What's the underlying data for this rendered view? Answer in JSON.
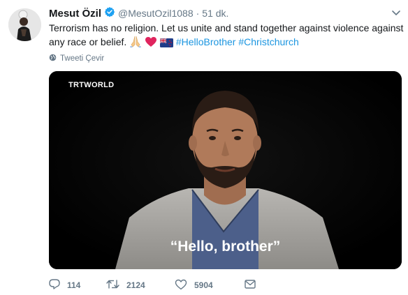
{
  "tweet": {
    "author": {
      "name": "Mesut Özil",
      "handle": "@MesutOzil1088",
      "separator": "·",
      "time": "51 dk."
    },
    "text_main": "Terrorism has no religion. Let us unite and stand together against violence against any race or belief.",
    "emojis": [
      "folded-hands",
      "red-heart",
      "new-zealand-flag"
    ],
    "hashtags": [
      "#HelloBrother",
      "#Christchurch"
    ],
    "translate_label": "Tweeti Çevir",
    "media": {
      "logo": "TRTWORLD",
      "caption": "“Hello, brother”"
    },
    "actions": {
      "replies": "114",
      "retweets": "2124",
      "likes": "5904"
    }
  },
  "colors": {
    "link": "#1b95e0",
    "muted": "#657786",
    "text": "#14171a",
    "verified": "#1da1f2",
    "heart": "#e0245e"
  }
}
